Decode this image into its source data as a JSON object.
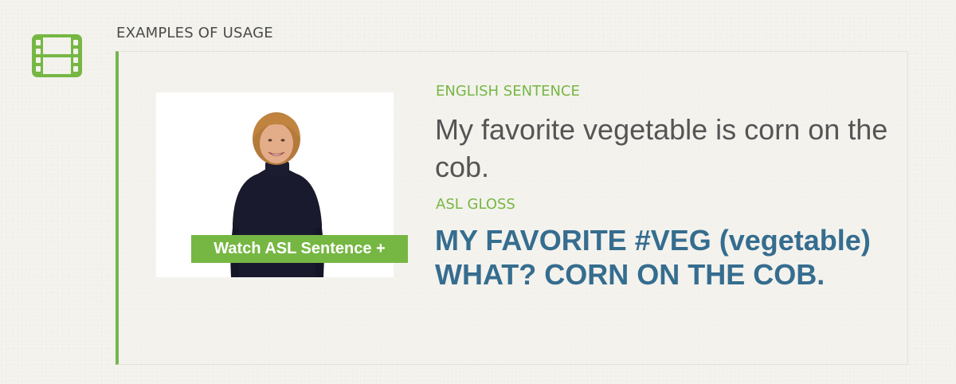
{
  "section": {
    "icon": "film-icon",
    "label": "EXAMPLES OF USAGE"
  },
  "example": {
    "video": {
      "thumbnail": "signer-woman-thumbnail",
      "watch_label": "Watch ASL Sentence +"
    },
    "english_label": "ENGLISH SENTENCE",
    "english_sentence": "My favorite vegetable is corn on the cob.",
    "gloss_label": "ASL GLOSS",
    "gloss_sentence": "MY FAVORITE #VEG (vegetable) WHAT? CORN ON THE COB."
  },
  "colors": {
    "accent_green": "#76b744",
    "gloss_blue": "#356d8f",
    "text_gray": "#555555",
    "background": "#f3f2ec"
  }
}
